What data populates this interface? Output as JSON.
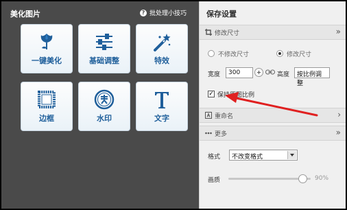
{
  "left": {
    "title": "美化图片",
    "tips_label": "批处理小技巧",
    "tools": [
      {
        "label": "一键美化",
        "icon": "tulip-icon"
      },
      {
        "label": "基础调整",
        "icon": "sliders-icon"
      },
      {
        "label": "特效",
        "icon": "magic-wand-icon"
      },
      {
        "label": "边框",
        "icon": "frame-icon"
      },
      {
        "label": "水印",
        "icon": "watermark-stamp-icon"
      },
      {
        "label": "文字",
        "icon": "text-t-icon"
      }
    ]
  },
  "right": {
    "title": "保存设置",
    "resize": {
      "header": "修改尺寸",
      "option_keep": "不修改尺寸",
      "option_change": "修改尺寸",
      "selected": "修改尺寸",
      "width_label": "宽度",
      "width_value": "300",
      "height_label": "高度",
      "height_value": "按比例调整",
      "keep_ratio_label": "保持原图比例",
      "keep_ratio_checked": true
    },
    "rename": {
      "header": "重命名"
    },
    "more": {
      "header": "更多",
      "format_label": "格式",
      "format_value": "不改变格式",
      "quality_label": "画质",
      "quality_value": "90%",
      "quality_fraction": 0.9
    }
  },
  "colors": {
    "accent_blue": "#1f5f9b",
    "arrow_red": "#e02020"
  }
}
